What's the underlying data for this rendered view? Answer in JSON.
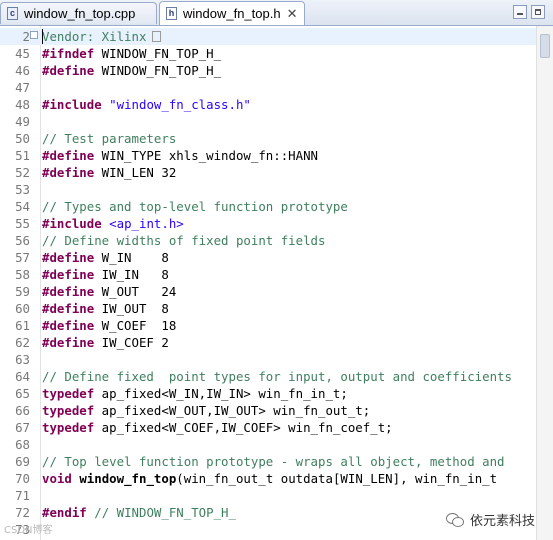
{
  "tabs": [
    {
      "name": "window_fn_top.cpp",
      "icon": "cpp-file-icon",
      "active": false
    },
    {
      "name": "window_fn_top.h",
      "icon": "header-file-icon",
      "active": true,
      "close": "✕"
    }
  ],
  "editor": {
    "lines": [
      {
        "num": "2",
        "fold": "⊕",
        "current": true,
        "tokens": [
          {
            "t": "cm",
            "v": "Vendor: Xilinx"
          }
        ],
        "collapsed": true
      },
      {
        "num": "45",
        "tokens": [
          {
            "t": "kw",
            "v": "#ifndef"
          },
          {
            "t": "tx",
            "v": " WINDOW_FN_TOP_H_"
          }
        ]
      },
      {
        "num": "46",
        "tokens": [
          {
            "t": "kw",
            "v": "#define"
          },
          {
            "t": "tx",
            "v": " WINDOW_FN_TOP_H_"
          }
        ]
      },
      {
        "num": "47",
        "tokens": []
      },
      {
        "num": "48",
        "tokens": [
          {
            "t": "kw",
            "v": "#include"
          },
          {
            "t": "tx",
            "v": " "
          },
          {
            "t": "st",
            "v": "\"window_fn_class.h\""
          }
        ]
      },
      {
        "num": "49",
        "tokens": []
      },
      {
        "num": "50",
        "tokens": [
          {
            "t": "cm",
            "v": "// Test parameters"
          }
        ]
      },
      {
        "num": "51",
        "tokens": [
          {
            "t": "kw",
            "v": "#define"
          },
          {
            "t": "tx",
            "v": " WIN_TYPE xhls_window_fn::HANN"
          }
        ]
      },
      {
        "num": "52",
        "tokens": [
          {
            "t": "kw",
            "v": "#define"
          },
          {
            "t": "tx",
            "v": " WIN_LEN 32"
          }
        ]
      },
      {
        "num": "53",
        "tokens": []
      },
      {
        "num": "54",
        "tokens": [
          {
            "t": "cm",
            "v": "// Types and top-level function prototype"
          }
        ]
      },
      {
        "num": "55",
        "tokens": [
          {
            "t": "kw",
            "v": "#include"
          },
          {
            "t": "tx",
            "v": " "
          },
          {
            "t": "st",
            "v": "<ap_int.h>"
          }
        ]
      },
      {
        "num": "56",
        "tokens": [
          {
            "t": "cm",
            "v": "// Define widths of fixed point fields"
          }
        ]
      },
      {
        "num": "57",
        "tokens": [
          {
            "t": "kw",
            "v": "#define"
          },
          {
            "t": "tx",
            "v": " W_IN    8"
          }
        ]
      },
      {
        "num": "58",
        "tokens": [
          {
            "t": "kw",
            "v": "#define"
          },
          {
            "t": "tx",
            "v": " IW_IN   8"
          }
        ]
      },
      {
        "num": "59",
        "tokens": [
          {
            "t": "kw",
            "v": "#define"
          },
          {
            "t": "tx",
            "v": " W_OUT   24"
          }
        ]
      },
      {
        "num": "60",
        "tokens": [
          {
            "t": "kw",
            "v": "#define"
          },
          {
            "t": "tx",
            "v": " IW_OUT  8"
          }
        ]
      },
      {
        "num": "61",
        "tokens": [
          {
            "t": "kw",
            "v": "#define"
          },
          {
            "t": "tx",
            "v": " W_COEF  18"
          }
        ]
      },
      {
        "num": "62",
        "tokens": [
          {
            "t": "kw",
            "v": "#define"
          },
          {
            "t": "tx",
            "v": " IW_COEF 2"
          }
        ]
      },
      {
        "num": "63",
        "tokens": []
      },
      {
        "num": "64",
        "tokens": [
          {
            "t": "cm",
            "v": "// Define fixed  point types for input, output and coefficients"
          }
        ]
      },
      {
        "num": "65",
        "tokens": [
          {
            "t": "kw",
            "v": "typedef"
          },
          {
            "t": "tx",
            "v": " ap_fixed<W_IN,IW_IN> win_fn_in_t;"
          }
        ]
      },
      {
        "num": "66",
        "tokens": [
          {
            "t": "kw",
            "v": "typedef"
          },
          {
            "t": "tx",
            "v": " ap_fixed<W_OUT,IW_OUT> win_fn_out_t;"
          }
        ]
      },
      {
        "num": "67",
        "tokens": [
          {
            "t": "kw",
            "v": "typedef"
          },
          {
            "t": "tx",
            "v": " ap_fixed<W_COEF,IW_COEF> win_fn_coef_t;"
          }
        ]
      },
      {
        "num": "68",
        "tokens": []
      },
      {
        "num": "69",
        "tokens": [
          {
            "t": "cm",
            "v": "// Top level function prototype - wraps all object, method and"
          }
        ]
      },
      {
        "num": "70",
        "tokens": [
          {
            "t": "kw",
            "v": "void"
          },
          {
            "t": "tx",
            "v": " "
          },
          {
            "t": "kwb",
            "v": "window_fn_top"
          },
          {
            "t": "tx",
            "v": "(win_fn_out_t outdata[WIN_LEN], win_fn_in_t"
          }
        ]
      },
      {
        "num": "71",
        "tokens": []
      },
      {
        "num": "72",
        "tokens": [
          {
            "t": "kw",
            "v": "#endif"
          },
          {
            "t": "tx",
            "v": " "
          },
          {
            "t": "cm",
            "v": "// WINDOW_FN_TOP_H_"
          }
        ]
      },
      {
        "num": "73",
        "tokens": []
      }
    ]
  },
  "watermark": {
    "text": "依元素科技",
    "icon": "wechat-icon",
    "left_text": "CSDN博客"
  }
}
